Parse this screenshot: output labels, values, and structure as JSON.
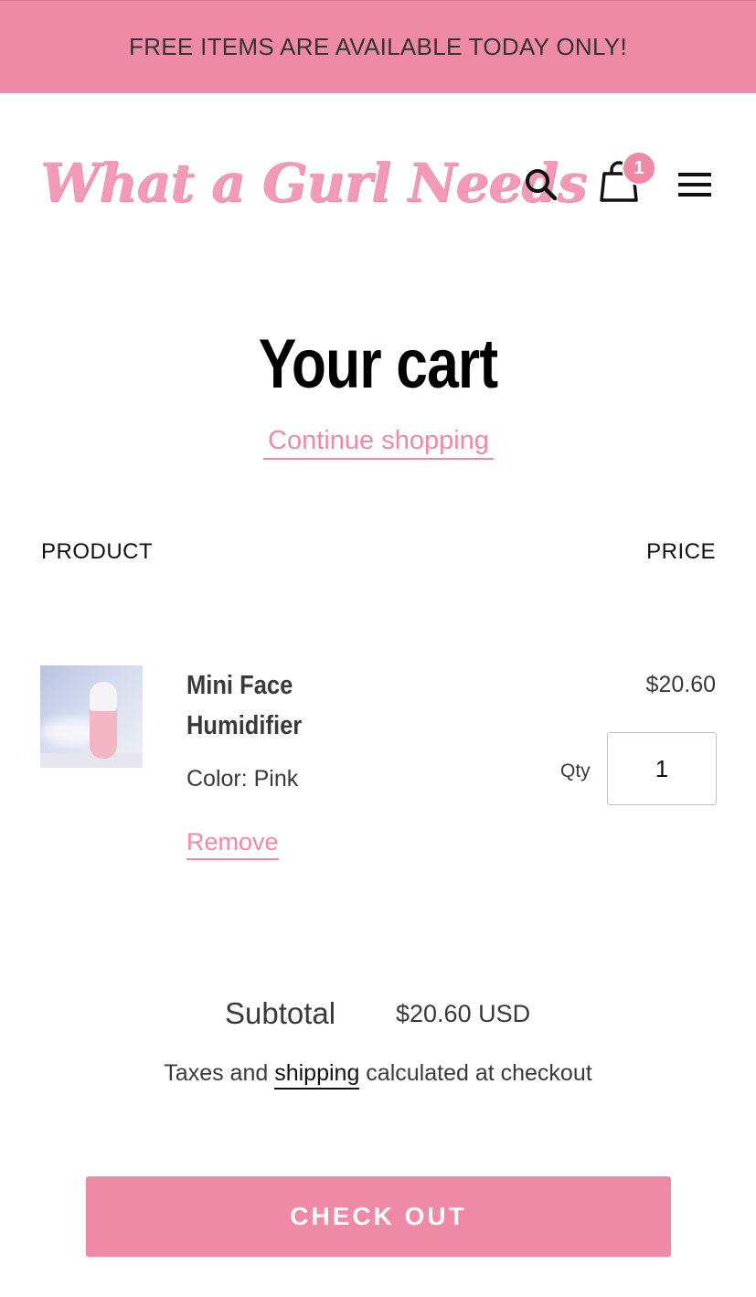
{
  "announcement": {
    "text": "FREE ITEMS ARE AVAILABLE TODAY ONLY!"
  },
  "header": {
    "logo_text": "What a Gurl Needs",
    "cart_count": "1",
    "icons": [
      "search-icon",
      "cart-icon",
      "hamburger-menu-icon"
    ]
  },
  "cart": {
    "title": "Your cart",
    "continue_label": "Continue shopping",
    "columns": {
      "product": "PRODUCT",
      "price": "PRICE"
    },
    "items": [
      {
        "name": "Mini Face Humidifier",
        "variant": "Color: Pink",
        "remove_label": "Remove",
        "price": "$20.60",
        "qty_label": "Qty",
        "qty_value": "1"
      }
    ],
    "subtotal_label": "Subtotal",
    "subtotal_value": "$20.60 USD",
    "tax_note_before": "Taxes and ",
    "tax_note_link": "shipping",
    "tax_note_after": " calculated at checkout",
    "checkout_label": "CHECK OUT"
  },
  "colors": {
    "accent": "#ee8aa6",
    "text": "#3a3a3a",
    "heading": "#000000"
  }
}
